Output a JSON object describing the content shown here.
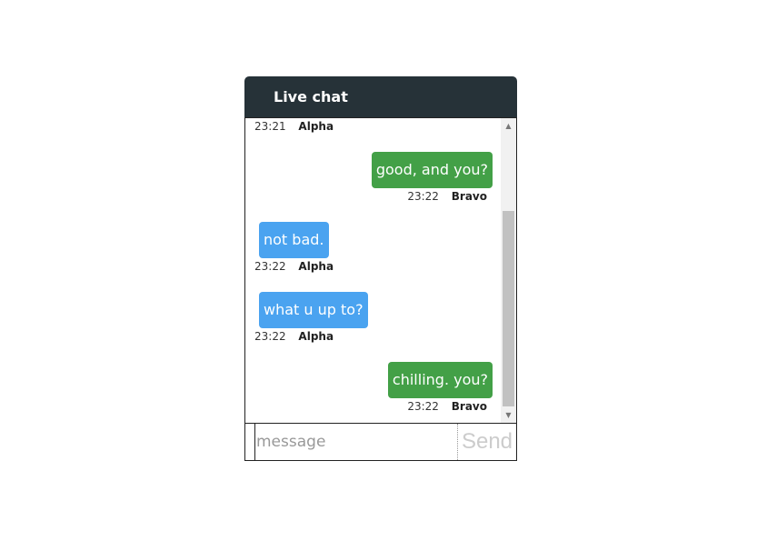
{
  "header": {
    "title": "Live chat"
  },
  "messages": [
    {
      "direction": "in",
      "text": "",
      "time": "23:21",
      "sender": "Alpha"
    },
    {
      "direction": "out",
      "text": "good, and you?",
      "time": "23:22",
      "sender": "Bravo"
    },
    {
      "direction": "in",
      "text": "not bad.",
      "time": "23:22",
      "sender": "Alpha"
    },
    {
      "direction": "in",
      "text": "what u up to?",
      "time": "23:22",
      "sender": "Alpha"
    },
    {
      "direction": "out",
      "text": "chilling. you?",
      "time": "23:22",
      "sender": "Bravo"
    }
  ],
  "composer": {
    "placeholder": "message",
    "value": "",
    "send_label": "Send"
  },
  "scrollbar": {
    "up_icon": "triangle-up-icon",
    "down_icon": "triangle-down-icon"
  },
  "colors": {
    "header_bg": "#263238",
    "incoming_bubble": "#4aa3f0",
    "outgoing_bubble": "#43a047"
  }
}
